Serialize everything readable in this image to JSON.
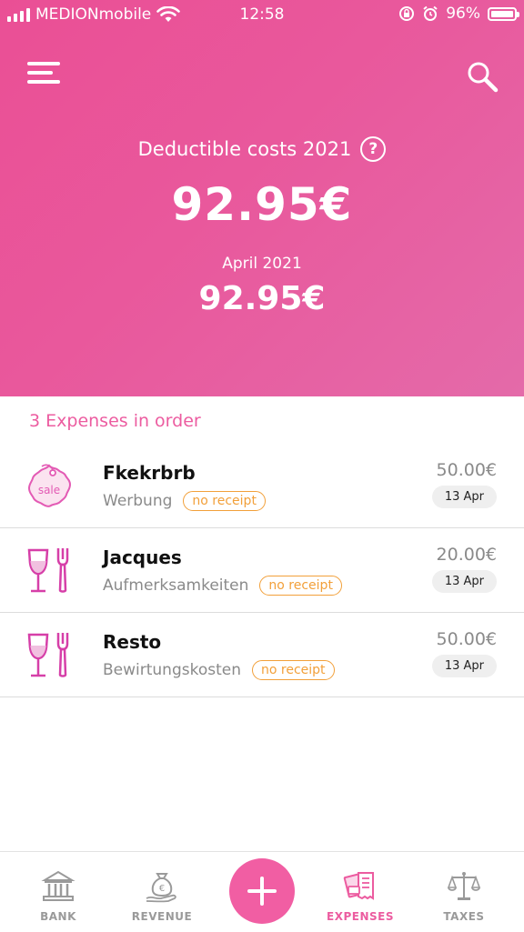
{
  "status_bar": {
    "carrier": "MEDIONmobile",
    "time": "12:58",
    "battery": "96%",
    "battery_level": 0.96
  },
  "header": {
    "summary_label": "Deductible costs 2021",
    "help_label": "?",
    "total_amount": "92.95€",
    "month_label": "April 2021",
    "month_amount": "92.95€",
    "background_color": "#ea4f95"
  },
  "expenses": {
    "title": "3 Expenses in order",
    "items": [
      {
        "name": "Fkekrbrb",
        "category": "Werbung",
        "badge": "no receipt",
        "amount": "50.00€",
        "date": "13 Apr",
        "icon": "sale-tag-icon"
      },
      {
        "name": "Jacques",
        "category": "Aufmerksamkeiten",
        "badge": "no receipt",
        "amount": "20.00€",
        "date": "13 Apr",
        "icon": "wine-fork-icon"
      },
      {
        "name": "Resto",
        "category": "Bewirtungskosten",
        "badge": "no receipt",
        "amount": "50.00€",
        "date": "13 Apr",
        "icon": "wine-fork-icon"
      }
    ]
  },
  "sale_tag_text": "sale",
  "tabs": [
    {
      "label": "BANK",
      "icon": "bank-icon"
    },
    {
      "label": "REVENUE",
      "icon": "money-bag-icon"
    },
    {
      "label": "EXPENSES",
      "icon": "receipts-icon",
      "active": true
    },
    {
      "label": "TAXES",
      "icon": "scales-icon"
    }
  ],
  "colors": {
    "accent": "#ec5ca0",
    "badge": "#f2a03a",
    "fab": "#f15ea3"
  }
}
